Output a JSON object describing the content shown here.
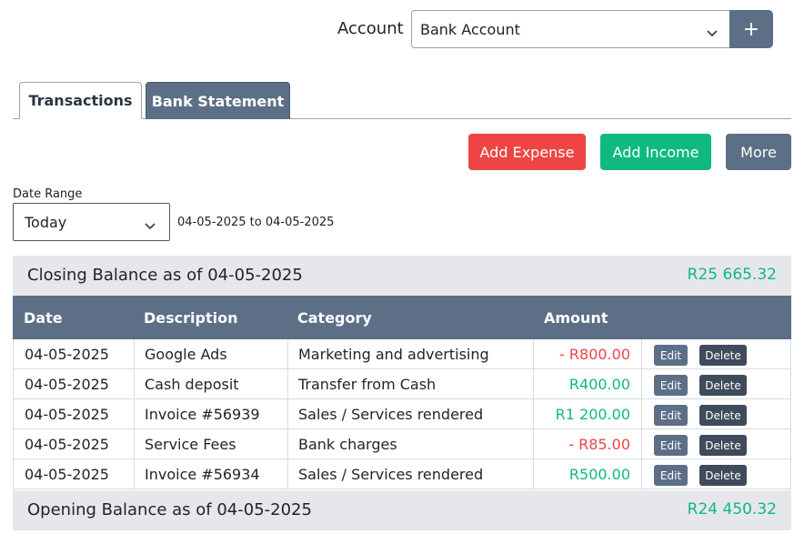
{
  "account": {
    "label": "Account",
    "selected": "Bank Account",
    "add_label": "+"
  },
  "tabs": [
    {
      "label": "Transactions",
      "active": true
    },
    {
      "label": "Bank Statement",
      "active": false
    }
  ],
  "actions": {
    "add_expense": "Add Expense",
    "add_income": "Add Income",
    "more": "More"
  },
  "date_range": {
    "label": "Date Range",
    "selected": "Today",
    "range_text": "04-05-2025 to 04-05-2025"
  },
  "closing_balance": {
    "label": "Closing Balance as of 04-05-2025",
    "amount": "R25 665.32"
  },
  "table": {
    "headers": [
      "Date",
      "Description",
      "Category",
      "Amount"
    ],
    "edit_label": "Edit",
    "delete_label": "Delete",
    "rows": [
      {
        "date": "04-05-2025",
        "description": "Google Ads",
        "category": "Marketing and advertising",
        "amount": "- R800.00",
        "type": "neg"
      },
      {
        "date": "04-05-2025",
        "description": "Cash deposit",
        "category": "Transfer from Cash",
        "amount": "R400.00",
        "type": "pos"
      },
      {
        "date": "04-05-2025",
        "description": "Invoice #56939",
        "category": "Sales / Services rendered",
        "amount": "R1 200.00",
        "type": "pos"
      },
      {
        "date": "04-05-2025",
        "description": "Service Fees",
        "category": "Bank charges",
        "amount": "- R85.00",
        "type": "neg"
      },
      {
        "date": "04-05-2025",
        "description": "Invoice #56934",
        "category": "Sales / Services rendered",
        "amount": "R500.00",
        "type": "pos"
      }
    ]
  },
  "opening_balance": {
    "label": "Opening Balance as of 04-05-2025",
    "amount": "R24 450.32"
  },
  "colors": {
    "primary": "#5c6f86",
    "danger": "#ef4444",
    "success": "#10b981"
  }
}
